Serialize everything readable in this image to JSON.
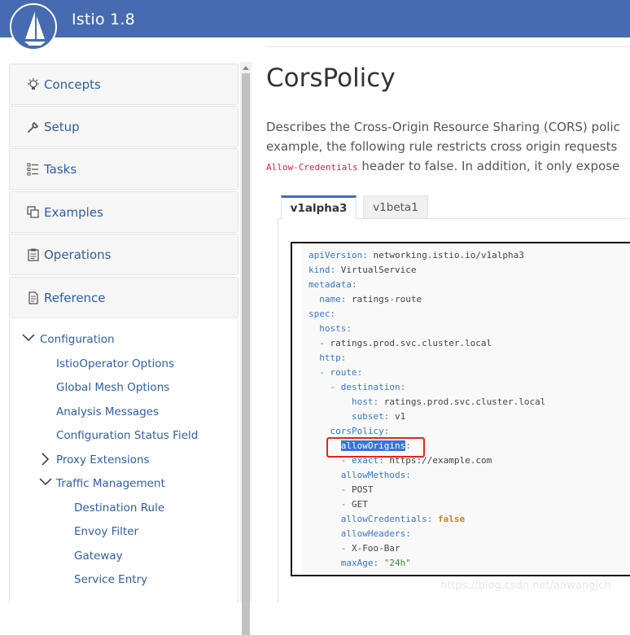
{
  "header": {
    "brand": "Istio 1.8",
    "accent": "#466bb0"
  },
  "sidebar": {
    "cards": [
      {
        "label": "Concepts",
        "icon": "lightbulb-icon"
      },
      {
        "label": "Setup",
        "icon": "wrench-icon"
      },
      {
        "label": "Tasks",
        "icon": "checklist-icon"
      },
      {
        "label": "Examples",
        "icon": "layers-icon"
      },
      {
        "label": "Operations",
        "icon": "clipboard-icon"
      },
      {
        "label": "Reference",
        "icon": "document-icon"
      }
    ],
    "tree": {
      "configuration": "Configuration",
      "config_items": [
        "IstioOperator Options",
        "Global Mesh Options",
        "Analysis Messages",
        "Configuration Status Field"
      ],
      "proxy_extensions": "Proxy Extensions",
      "traffic_management": "Traffic Management",
      "traffic_items": [
        "Destination Rule",
        "Envoy Filter",
        "Gateway",
        "Service Entry"
      ]
    }
  },
  "main": {
    "title": "CorsPolicy",
    "desc_line1": "Describes the Cross-Origin Resource Sharing (CORS) polic",
    "desc_line2": "example, the following rule restricts cross origin requests",
    "desc_code": "Allow-Credentials",
    "desc_line3_rest": " header to false. In addition, it only expose",
    "tabs": [
      "v1alpha3",
      "v1beta1"
    ],
    "code": {
      "l1k": "apiVersion",
      "l1v": "networking.istio.io/v1alpha3",
      "l2k": "kind",
      "l2v": "VirtualService",
      "l3k": "metadata",
      "l4k": "name",
      "l4v": "ratings-route",
      "l5k": "spec",
      "l6k": "hosts",
      "l7v": "ratings.prod.svc.cluster.local",
      "l8k": "http",
      "l9k": "route",
      "l10k": "destination",
      "l11k": "host",
      "l11v": "ratings.prod.svc.cluster.local",
      "l12k": "subset",
      "l12v": "v1",
      "l13k": "corsPolicy",
      "l14k": "allowOrigins",
      "l15k": "exact",
      "l15v": "https://example.com",
      "l16k": "allowMethods",
      "l17v": "POST",
      "l18v": "GET",
      "l19k": "allowCredentials",
      "l19v": "false",
      "l20k": "allowHeaders",
      "l21v": "X-Foo-Bar",
      "l22k": "maxAge",
      "l22v": "\"24h\""
    }
  },
  "watermark": "https://blog.csdn.net/ahwangjch"
}
